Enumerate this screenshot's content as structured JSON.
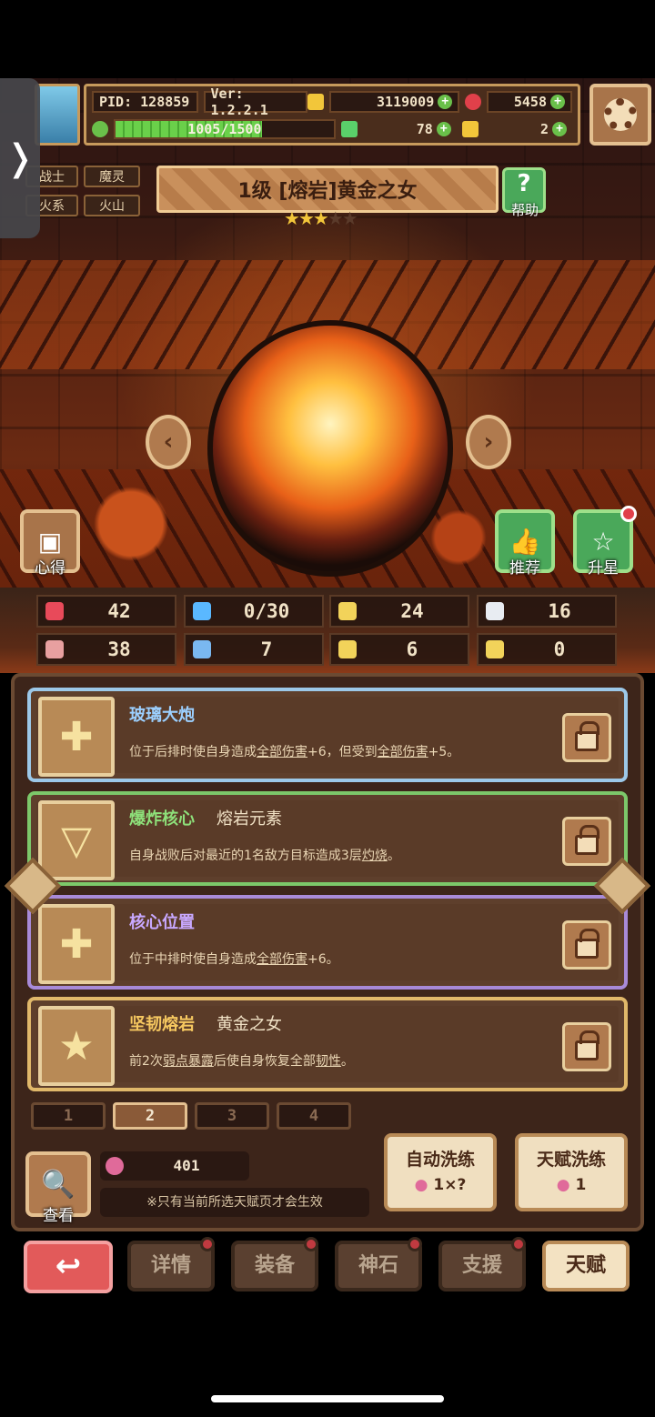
{
  "header": {
    "pid": "PID: 128859",
    "version": "Ver: 1.2.2.1",
    "hp_text": "1005/1500",
    "hp_fraction": 0.67,
    "gold": "3119009",
    "gems": "5458",
    "clover": "78",
    "keys": "2"
  },
  "tags": [
    "战士",
    "魔灵",
    "火系",
    "火山"
  ],
  "hero": {
    "title": "1级  [熔岩]黄金之女",
    "stars_filled": 3,
    "stars_total": 5
  },
  "buttons": {
    "help": "帮助",
    "notes": "心得",
    "recommend": "推荐",
    "star_up": "升星"
  },
  "stats": [
    {
      "icon": "heart-icon",
      "value": "42",
      "color": "#e84a5a"
    },
    {
      "icon": "drop-icon",
      "value": "0/30",
      "color": "#5ab8ff"
    },
    {
      "icon": "shield-icon",
      "value": "24",
      "color": "#f2d35a"
    },
    {
      "icon": "wing-icon",
      "value": "16",
      "color": "#e8ecf2"
    },
    {
      "icon": "fist-icon",
      "value": "38",
      "color": "#e8a0a0"
    },
    {
      "icon": "book-icon",
      "value": "7",
      "color": "#7ab8f0"
    },
    {
      "icon": "scroll-icon",
      "value": "6",
      "color": "#f2d35a"
    },
    {
      "icon": "horseshoe-icon",
      "value": "0",
      "color": "#f2d35a"
    }
  ],
  "talents": [
    {
      "name": "玻璃大炮",
      "sub": "",
      "desc_pre": "位于后排时使自身造成",
      "desc_u1": "全部伤害",
      "desc_mid": "+6，但受到",
      "desc_u2": "全部伤害",
      "desc_post": "+5。",
      "border": "#9cc8e8",
      "title_color": "#9cd0ff",
      "icon": "plus-icon"
    },
    {
      "name": "爆炸核心",
      "sub": "熔岩元素",
      "desc_pre": "自身战败后对最近的1名敌方目标造成3层",
      "desc_u1": "灼烧",
      "desc_mid": "。",
      "desc_u2": "",
      "desc_post": "",
      "border": "#7cc86a",
      "title_color": "#8ee07a",
      "icon": "triangle-icon"
    },
    {
      "name": "核心位置",
      "sub": "",
      "desc_pre": "位于中排时使自身造成",
      "desc_u1": "全部伤害",
      "desc_mid": "+6。",
      "desc_u2": "",
      "desc_post": "",
      "border": "#a88ad8",
      "title_color": "#c8a8ff",
      "icon": "plus-icon"
    },
    {
      "name": "坚韧熔岩",
      "sub": "黄金之女",
      "desc_pre": "前2次",
      "desc_u1": "弱点暴露",
      "desc_mid": "后使自身恢复全部",
      "desc_u2": "韧性",
      "desc_post": "。",
      "border": "#e0b86a",
      "title_color": "#f6c860",
      "icon": "star-icon"
    }
  ],
  "pages": [
    "1",
    "2",
    "3",
    "4"
  ],
  "active_page": 1,
  "resource": {
    "value": "401",
    "note": "※只有当前所选天赋页才会生效"
  },
  "view_label": "查看",
  "auto_reroll": {
    "label": "自动洗练",
    "cost": "1×?"
  },
  "talent_reroll": {
    "label": "天赋洗练",
    "cost": "1"
  },
  "nav": [
    "详情",
    "装备",
    "神石",
    "支援",
    "天赋"
  ]
}
